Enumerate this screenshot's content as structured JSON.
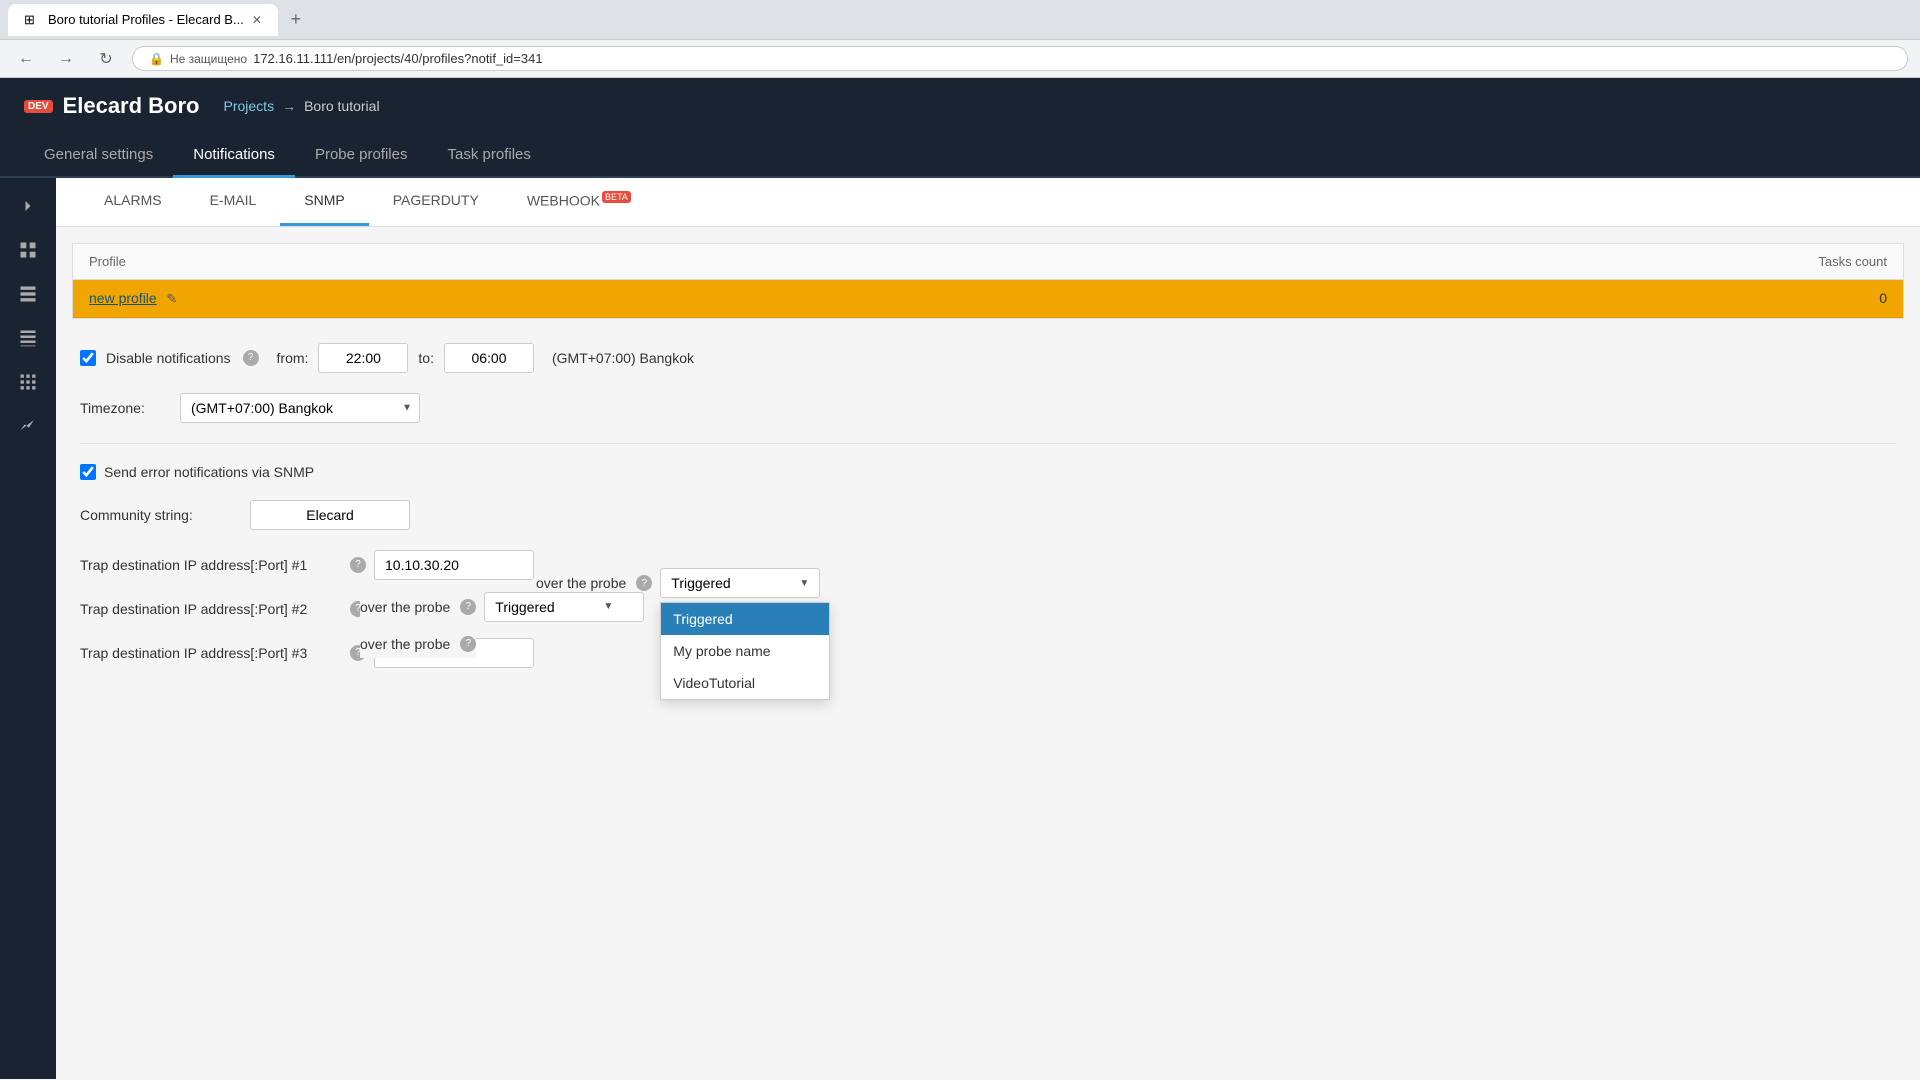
{
  "browser": {
    "tab_title": "Boro tutorial Profiles - Elecard B...",
    "new_tab_label": "+",
    "back_btn": "←",
    "forward_btn": "→",
    "refresh_btn": "↻",
    "url": "172.16.11.111/en/projects/40/profiles?notif_id=341",
    "lock_label": "Не защищено",
    "favicon": "⊞"
  },
  "app": {
    "dev_badge": "DEV",
    "logo": "Elecard Boro",
    "breadcrumb_projects": "Projects",
    "breadcrumb_arrow": "→",
    "breadcrumb_current": "Boro tutorial"
  },
  "main_nav": {
    "items": [
      {
        "id": "general",
        "label": "General settings",
        "active": false
      },
      {
        "id": "notifications",
        "label": "Notifications",
        "active": true
      },
      {
        "id": "probe",
        "label": "Probe profiles",
        "active": false
      },
      {
        "id": "task",
        "label": "Task profiles",
        "active": false
      }
    ]
  },
  "sidebar": {
    "items": [
      {
        "id": "expand",
        "icon": "chevron-right"
      },
      {
        "id": "dashboard",
        "icon": "grid"
      },
      {
        "id": "list",
        "icon": "list-grid"
      },
      {
        "id": "table",
        "icon": "table-lines"
      },
      {
        "id": "table2",
        "icon": "table-grid"
      },
      {
        "id": "chart",
        "icon": "chart-line"
      }
    ]
  },
  "sub_tabs": {
    "items": [
      {
        "id": "alarms",
        "label": "ALARMS",
        "active": false
      },
      {
        "id": "email",
        "label": "E-MAIL",
        "active": false
      },
      {
        "id": "snmp",
        "label": "SNMP",
        "active": true
      },
      {
        "id": "pagerduty",
        "label": "PAGERDUTY",
        "active": false
      },
      {
        "id": "webhook",
        "label": "WEBHOOK",
        "active": false,
        "beta": true
      }
    ]
  },
  "table": {
    "col_profile": "Profile",
    "col_tasks": "Tasks count",
    "rows": [
      {
        "profile_name": "new profile",
        "tasks_count": "0"
      }
    ]
  },
  "settings": {
    "disable_notifications_label": "Disable notifications",
    "from_label": "from:",
    "from_value": "22:00",
    "to_label": "to:",
    "to_value": "06:00",
    "timezone_display": "(GMT+07:00) Bangkok",
    "timezone_label": "Timezone:",
    "timezone_value": "(GMT+07:00) Bangkok",
    "send_error_label": "Send error notifications via SNMP",
    "community_label": "Community string:",
    "community_value": "Elecard",
    "trap_dest_1_label": "Trap destination IP address[:Port] #1",
    "trap_dest_1_value": "10.10.30.20",
    "trap_dest_2_label": "Trap destination IP address[:Port] #2",
    "trap_dest_2_value": "",
    "trap_dest_3_label": "Trap destination IP address[:Port] #3",
    "trap_dest_3_value": ""
  },
  "dropdown": {
    "over_probe_label": "over the probe",
    "selected_value": "Triggered",
    "options": [
      {
        "id": "triggered",
        "label": "Triggered",
        "selected": true
      },
      {
        "id": "probe_name",
        "label": "My probe name",
        "selected": false
      },
      {
        "id": "video_tutorial",
        "label": "VideoTutorial",
        "selected": false
      }
    ]
  },
  "icons": {
    "chevron_right": "❯",
    "grid": "⊞",
    "list": "≡",
    "table": "▦",
    "chart": "📈",
    "edit": "✎",
    "help": "?",
    "dropdown_arrow": "▼"
  }
}
